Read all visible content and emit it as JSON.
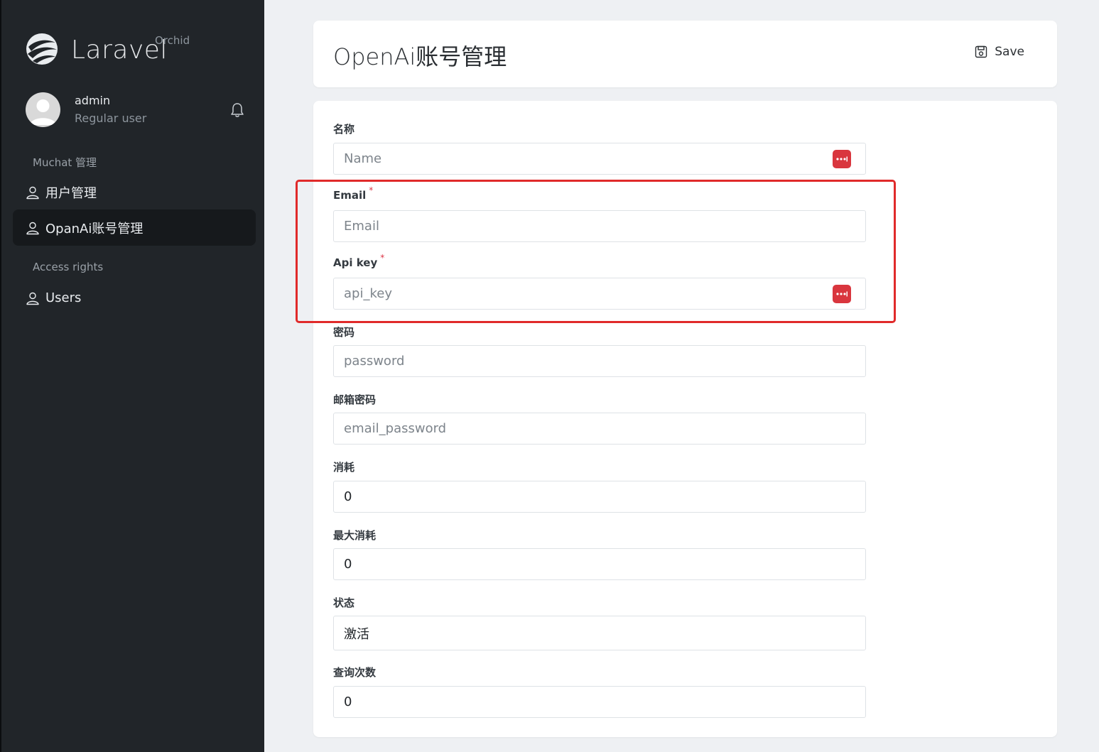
{
  "brand": {
    "name": "Laravel",
    "sub": "Orchid"
  },
  "profile": {
    "name": "admin",
    "role": "Regular user"
  },
  "sidebar": {
    "sections": [
      {
        "title": "Muchat 管理",
        "items": [
          {
            "label": "用户管理"
          },
          {
            "label": "OpanAi账号管理",
            "active": true
          }
        ]
      },
      {
        "title": "Access rights",
        "items": [
          {
            "label": "Users"
          }
        ]
      }
    ]
  },
  "header": {
    "title": "OpenAi账号管理",
    "save_label": "Save"
  },
  "form": {
    "fields": [
      {
        "label": "名称",
        "placeholder": "Name",
        "value": "",
        "required": false
      },
      {
        "label": "Email",
        "placeholder": "Email",
        "value": "",
        "required": true
      },
      {
        "label": "Api key",
        "placeholder": "api_key",
        "value": "",
        "required": true
      },
      {
        "label": "密码",
        "placeholder": "password",
        "value": "",
        "required": false
      },
      {
        "label": "邮箱密码",
        "placeholder": "email_password",
        "value": "",
        "required": false
      },
      {
        "label": "消耗",
        "placeholder": "",
        "value": "0",
        "required": false
      },
      {
        "label": "最大消耗",
        "placeholder": "",
        "value": "0",
        "required": false
      },
      {
        "label": "状态",
        "placeholder": "",
        "value": "激活",
        "required": false
      },
      {
        "label": "查询次数",
        "placeholder": "",
        "value": "0",
        "required": false
      }
    ]
  },
  "colors": {
    "sidebar_bg": "#212529",
    "accent_red": "#d9363e",
    "highlight": "#e02a2a"
  }
}
